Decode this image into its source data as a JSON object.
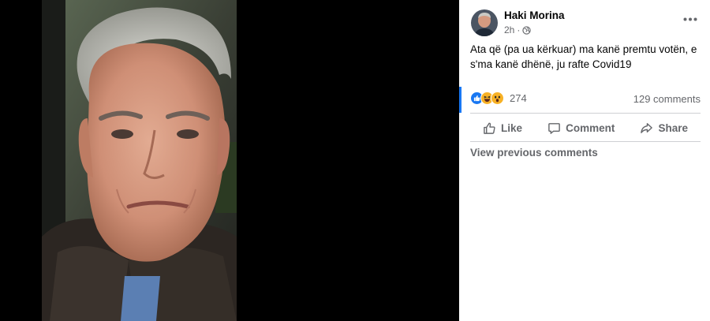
{
  "post": {
    "author": "Haki Morina",
    "time": "2h",
    "privacy_icon": "globe-icon",
    "text": "Ata që (pa ua kërkuar) ma kanë premtu votën, e s'ma kanë dhënë, ju rafte Covid19",
    "reactions": {
      "types": [
        "like",
        "haha",
        "wow"
      ],
      "count": "274"
    },
    "comments_count": "129 comments"
  },
  "actions": {
    "like_label": "Like",
    "comment_label": "Comment",
    "share_label": "Share"
  },
  "comments": {
    "view_previous": "View previous comments"
  },
  "colors": {
    "accent": "#1877f2",
    "secondary_text": "#65676b",
    "divider": "#ced0d4",
    "haha_yellow": "#f7b125"
  }
}
